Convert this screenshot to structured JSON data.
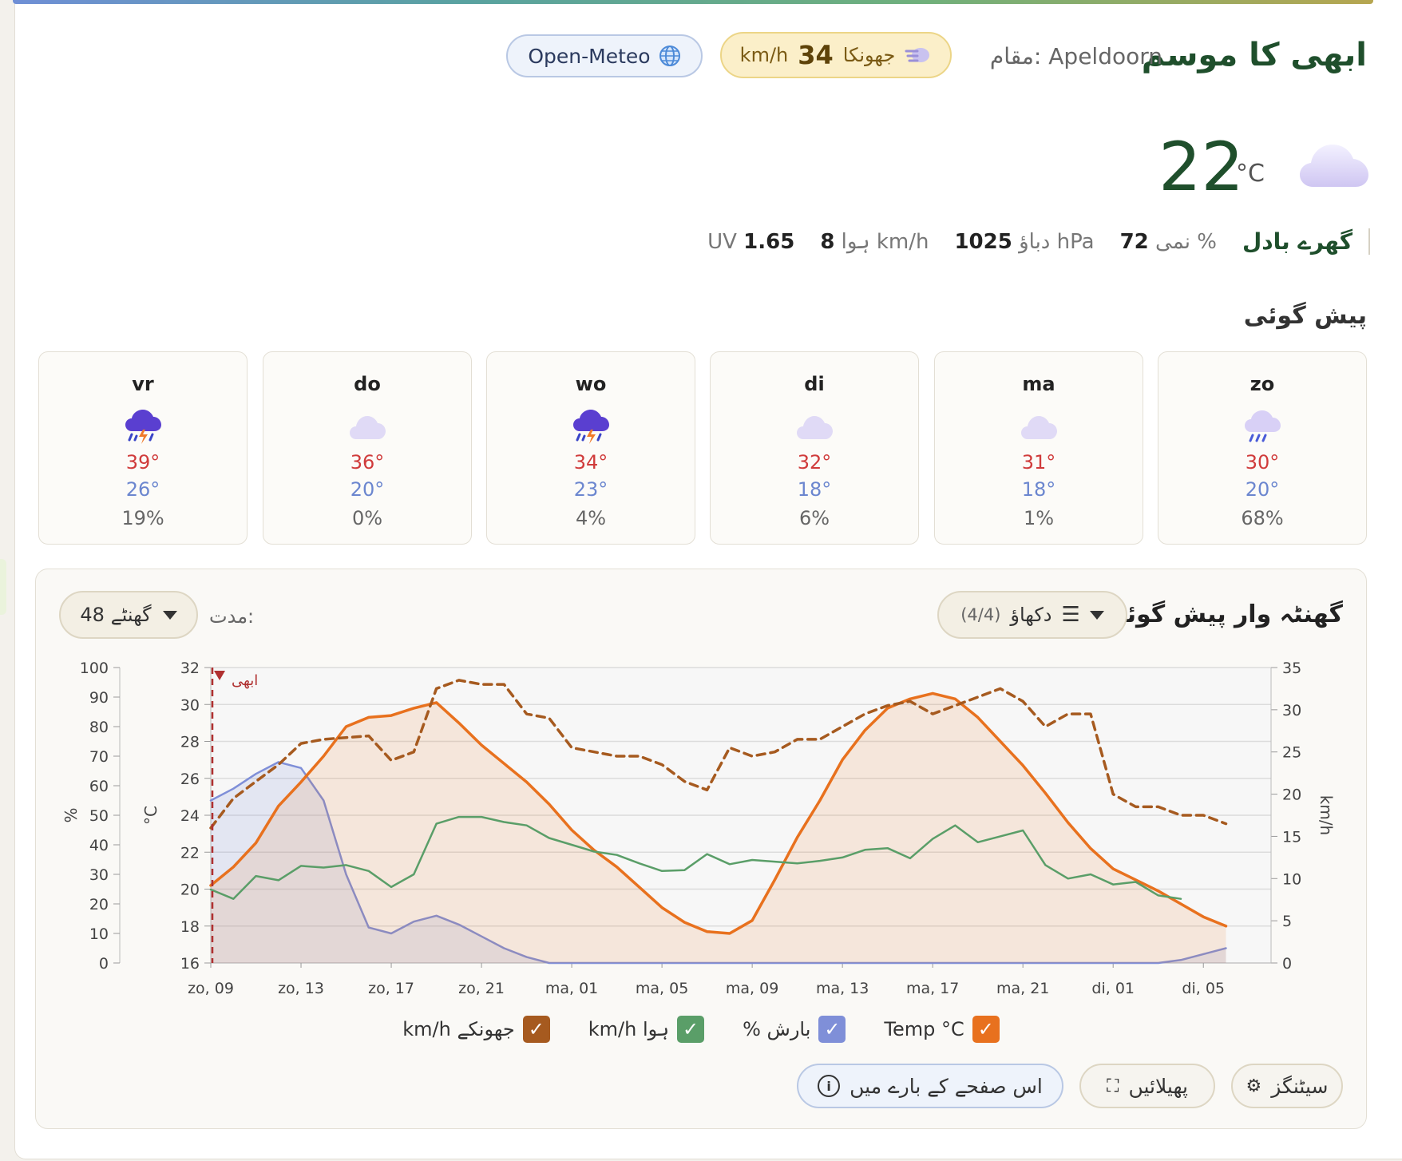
{
  "header": {
    "title": "ابھی کا موسم",
    "location_label": "مقام:",
    "location": "Apeldoorn",
    "gust_label": "جھونکا",
    "gust_value": "34",
    "gust_unit": "km/h",
    "source": "Open-Meteo"
  },
  "current": {
    "temp": "22",
    "unit": "°C",
    "icon": "cloud-icon",
    "condition": "گھرے بادل",
    "humidity_label": "نمی",
    "humidity_value": "72",
    "humidity_unit": "%",
    "pressure_label": "دباؤ",
    "pressure_value": "1025",
    "pressure_unit": "hPa",
    "wind_label": "ہوا",
    "wind_value": "8",
    "wind_unit": "km/h",
    "uv_label": "UV",
    "uv_value": "1.65"
  },
  "forecast": {
    "title": "پیش گوئی",
    "days": [
      {
        "name": "zo",
        "icon": "rain-icon",
        "high": "30°",
        "low": "20°",
        "precip": "68%"
      },
      {
        "name": "ma",
        "icon": "cloud-icon",
        "high": "31°",
        "low": "18°",
        "precip": "1%"
      },
      {
        "name": "di",
        "icon": "cloud-icon",
        "high": "32°",
        "low": "18°",
        "precip": "6%"
      },
      {
        "name": "wo",
        "icon": "thunderstorm-icon",
        "high": "34°",
        "low": "23°",
        "precip": "4%"
      },
      {
        "name": "do",
        "icon": "cloud-icon",
        "high": "36°",
        "low": "20°",
        "precip": "0%"
      },
      {
        "name": "vr",
        "icon": "thunderstorm-icon",
        "high": "39°",
        "low": "26°",
        "precip": "19%"
      }
    ]
  },
  "hourly": {
    "title": "گھنٹہ وار پیش گوئی",
    "show_label": "دکھاؤ",
    "show_count": "(4/4)",
    "duration_label": "مدت:",
    "duration_value": "48 گھنٹے"
  },
  "colors": {
    "temp": "#e8711e",
    "precip": "#7f8fd8",
    "wind": "#5a9e68",
    "gust": "#a65a1f",
    "now": "#b03030"
  },
  "chart_data": {
    "type": "line",
    "now_label": "ابھی",
    "x_ticks": [
      "zo, 09",
      "zo, 13",
      "zo, 17",
      "zo, 21",
      "ma, 01",
      "ma, 05",
      "ma, 09",
      "ma, 13",
      "ma, 17",
      "ma, 21",
      "di, 01",
      "di, 05"
    ],
    "y_left_pct": {
      "label": "%",
      "range": [
        0,
        100
      ],
      "ticks": [
        "0",
        "10",
        "20",
        "30",
        "40",
        "50",
        "60",
        "70",
        "80",
        "90",
        "100"
      ]
    },
    "y_left_temp": {
      "label": "°C",
      "range": [
        16,
        32
      ],
      "ticks": [
        "16",
        "18",
        "20",
        "22",
        "24",
        "26",
        "28",
        "30",
        "32"
      ]
    },
    "y_right": {
      "label": "km/h",
      "range": [
        0,
        35
      ],
      "ticks": [
        "0",
        "5",
        "10",
        "15",
        "20",
        "25",
        "30",
        "35"
      ]
    },
    "hours": [
      9,
      10,
      11,
      12,
      13,
      14,
      15,
      16,
      17,
      18,
      19,
      20,
      21,
      22,
      23,
      24,
      25,
      26,
      27,
      28,
      29,
      30,
      31,
      32,
      33,
      34,
      35,
      36,
      37,
      38,
      39,
      40,
      41,
      42,
      43,
      44,
      45,
      46,
      47,
      48,
      49,
      50,
      51,
      52,
      53,
      54,
      55,
      56
    ],
    "series": [
      {
        "name": "Temp °C",
        "axis": "temp",
        "values": [
          20.2,
          21.2,
          22.5,
          24.5,
          25.8,
          27.2,
          28.8,
          29.3,
          29.4,
          29.8,
          30.1,
          29.0,
          27.8,
          26.8,
          25.8,
          24.6,
          23.2,
          22.1,
          21.2,
          20.1,
          19.0,
          18.2,
          17.7,
          17.6,
          18.3,
          20.5,
          22.8,
          24.8,
          27.0,
          28.6,
          29.8,
          30.3,
          30.6,
          30.3,
          29.3,
          28.0,
          26.7,
          25.2,
          23.6,
          22.2,
          21.1,
          20.5,
          19.9,
          19.2,
          18.5,
          18.0
        ]
      },
      {
        "name": "بارش %",
        "axis": "pct",
        "values": [
          55,
          59,
          64,
          68,
          66,
          55,
          30,
          12,
          10,
          14,
          16,
          13,
          9,
          5,
          2,
          0,
          0,
          0,
          0,
          0,
          0,
          0,
          0,
          0,
          0,
          0,
          0,
          0,
          0,
          0,
          0,
          0,
          0,
          0,
          0,
          0,
          0,
          0,
          0,
          0,
          0,
          0,
          0,
          1,
          3,
          5
        ]
      },
      {
        "name": "ہوا km/h",
        "axis": "kmh",
        "values": [
          8.7,
          7.6,
          10.3,
          9.8,
          11.5,
          11.3,
          11.6,
          10.9,
          9.0,
          10.5,
          16.5,
          17.3,
          17.3,
          16.7,
          16.3,
          14.8,
          14.0,
          13.2,
          12.8,
          11.8,
          10.9,
          11.0,
          12.9,
          11.7,
          12.2,
          12.0,
          11.8,
          12.1,
          12.5,
          13.4,
          13.6,
          12.4,
          14.7,
          16.3,
          14.3,
          15.0,
          15.7,
          11.6,
          10.0,
          10.5,
          9.3,
          9.6,
          8.0,
          7.6
        ]
      },
      {
        "name": "جھونکے km/h",
        "axis": "kmh",
        "values": [
          16.0,
          19.5,
          21.5,
          23.5,
          26.0,
          26.5,
          26.7,
          26.9,
          24.0,
          25.0,
          32.5,
          33.5,
          33.0,
          33.0,
          29.5,
          29.0,
          25.5,
          25.0,
          24.5,
          24.5,
          23.5,
          21.5,
          20.5,
          25.5,
          24.5,
          25.0,
          26.5,
          26.5,
          28.0,
          29.5,
          30.5,
          31.0,
          29.5,
          30.5,
          31.5,
          32.5,
          31.0,
          28.0,
          29.5,
          29.5,
          20.0,
          18.5,
          18.5,
          17.5,
          17.5,
          16.5
        ]
      }
    ],
    "legend": [
      "Temp °C",
      "بارش %",
      "ہوا km/h",
      "جھونکے km/h"
    ]
  },
  "buttons": {
    "settings": "سیٹنگز",
    "expand": "پھیلائیں",
    "about": "اس صفحے کے بارے میں"
  }
}
